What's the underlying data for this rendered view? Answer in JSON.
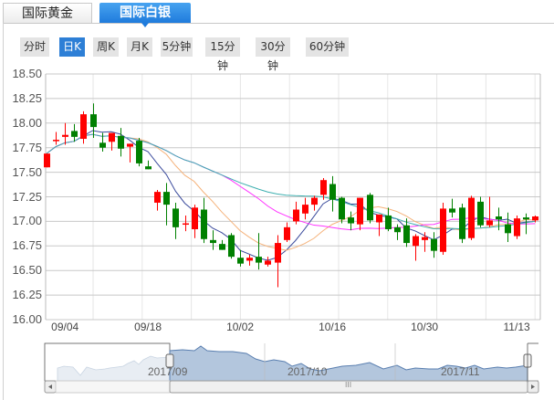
{
  "tabs": [
    {
      "label": "国际黄金",
      "active": false
    },
    {
      "label": "国际白银",
      "active": true
    }
  ],
  "periods": [
    {
      "label": "分时",
      "active": false
    },
    {
      "label": "日K",
      "active": true
    },
    {
      "label": "周K",
      "active": false
    },
    {
      "label": "月K",
      "active": false
    },
    {
      "label": "5分钟",
      "active": false
    },
    {
      "label": "15分钟",
      "active": false
    },
    {
      "label": "30分钟",
      "active": false
    },
    {
      "label": "60分钟",
      "active": false
    }
  ],
  "colors": {
    "up": "#ff0000",
    "down": "#008000",
    "accent": "#2d7fd6"
  },
  "chart_data": {
    "type": "candlestick",
    "ylim": [
      16.0,
      18.5
    ],
    "y_ticks": [
      "16.00",
      "16.25",
      "16.50",
      "16.75",
      "17.00",
      "17.25",
      "17.50",
      "17.75",
      "18.00",
      "18.25",
      "18.50"
    ],
    "x_ticks": [
      {
        "label": "09/04",
        "index": 2
      },
      {
        "label": "09/18",
        "index": 11
      },
      {
        "label": "10/02",
        "index": 21
      },
      {
        "label": "10/16",
        "index": 31
      },
      {
        "label": "10/30",
        "index": 41
      },
      {
        "label": "11/13",
        "index": 51
      }
    ],
    "grid": true,
    "ohlc": [
      [
        17.55,
        17.69,
        17.55,
        17.69
      ],
      [
        17.83,
        17.91,
        17.78,
        17.83
      ],
      [
        17.86,
        18.0,
        17.78,
        17.88
      ],
      [
        17.92,
        17.99,
        17.81,
        17.86
      ],
      [
        17.84,
        18.12,
        17.79,
        18.09
      ],
      [
        18.09,
        18.2,
        17.85,
        17.96
      ],
      [
        17.8,
        17.9,
        17.71,
        17.75
      ],
      [
        17.81,
        17.9,
        17.72,
        17.9
      ],
      [
        17.87,
        17.95,
        17.66,
        17.74
      ],
      [
        17.76,
        17.79,
        17.6,
        17.79
      ],
      [
        17.82,
        17.85,
        17.56,
        17.59
      ],
      [
        17.56,
        17.62,
        17.53,
        17.53
      ],
      [
        17.19,
        17.32,
        17.11,
        17.3
      ],
      [
        17.3,
        17.39,
        16.96,
        17.17
      ],
      [
        17.13,
        17.19,
        16.82,
        16.94
      ],
      [
        16.97,
        17.06,
        16.9,
        16.98
      ],
      [
        16.92,
        17.17,
        16.83,
        17.14
      ],
      [
        17.12,
        17.24,
        16.78,
        16.82
      ],
      [
        16.81,
        16.91,
        16.71,
        16.78
      ],
      [
        16.77,
        16.81,
        16.71,
        16.71
      ],
      [
        16.86,
        16.88,
        16.62,
        16.64
      ],
      [
        16.63,
        16.71,
        16.54,
        16.57
      ],
      [
        16.6,
        16.66,
        16.55,
        16.63
      ],
      [
        16.64,
        16.88,
        16.51,
        16.58
      ],
      [
        16.56,
        16.64,
        16.54,
        16.6
      ],
      [
        16.58,
        16.86,
        16.33,
        16.78
      ],
      [
        16.81,
        16.99,
        16.79,
        16.94
      ],
      [
        17.0,
        17.2,
        16.97,
        17.12
      ],
      [
        17.08,
        17.24,
        17.02,
        17.17
      ],
      [
        17.17,
        17.26,
        17.11,
        17.24
      ],
      [
        17.27,
        17.44,
        17.22,
        17.42
      ],
      [
        17.38,
        17.46,
        17.1,
        17.22
      ],
      [
        17.24,
        17.25,
        16.98,
        17.02
      ],
      [
        17.04,
        17.1,
        16.91,
        16.98
      ],
      [
        16.97,
        17.24,
        16.91,
        17.24
      ],
      [
        17.27,
        17.29,
        16.98,
        17.01
      ],
      [
        16.99,
        17.07,
        16.85,
        17.07
      ],
      [
        17.06,
        17.14,
        16.9,
        16.92
      ],
      [
        16.94,
        16.97,
        16.81,
        16.89
      ],
      [
        16.96,
        17.03,
        16.74,
        16.78
      ],
      [
        16.75,
        16.87,
        16.6,
        16.85
      ],
      [
        16.81,
        16.89,
        16.69,
        16.84
      ],
      [
        16.82,
        16.89,
        16.63,
        16.7
      ],
      [
        16.69,
        17.19,
        16.66,
        17.13
      ],
      [
        17.13,
        17.23,
        17.04,
        17.09
      ],
      [
        17.14,
        17.18,
        16.78,
        16.82
      ],
      [
        16.83,
        17.26,
        16.81,
        17.24
      ],
      [
        17.2,
        17.25,
        16.94,
        16.96
      ],
      [
        16.96,
        17.25,
        16.94,
        17.01
      ],
      [
        17.05,
        17.14,
        16.91,
        17.02
      ],
      [
        16.97,
        17.09,
        16.79,
        16.88
      ],
      [
        16.85,
        17.06,
        16.82,
        17.03
      ],
      [
        17.04,
        17.08,
        16.87,
        17.02
      ],
      [
        17.01,
        17.06,
        16.99,
        17.05
      ]
    ],
    "moving_averages": [
      {
        "period": 5,
        "color": "#3a4a9c"
      },
      {
        "period": 10,
        "color": "#f5b27a"
      },
      {
        "period": 20,
        "color": "#ff33ff"
      },
      {
        "period": 30,
        "color": "#3fb0b0"
      }
    ]
  },
  "navigator": {
    "labels": [
      "2017/09",
      "2017/10",
      "2017/11"
    ],
    "scroll_grip": "III"
  }
}
